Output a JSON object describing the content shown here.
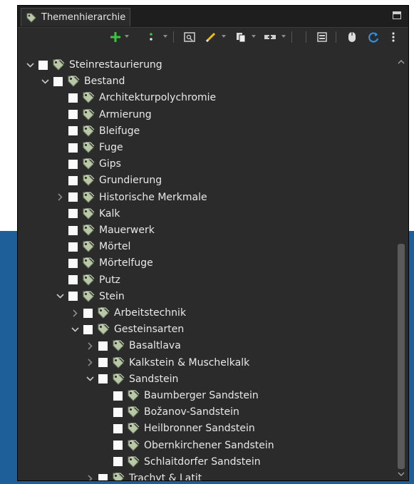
{
  "panel": {
    "tab_title": "Themenhierarchie"
  },
  "toolbar": {
    "icons": [
      "add-icon",
      "more-vert-icon",
      "search-window-icon",
      "pencil-icon",
      "copy-icon",
      "link-icon",
      "collapse-icon",
      "mouse-icon",
      "refresh-icon",
      "view-menu-icon"
    ]
  },
  "tree": {
    "rows": [
      {
        "label": "Steinrestaurierung",
        "depth": 0,
        "twisty": "open"
      },
      {
        "label": "Bestand",
        "depth": 1,
        "twisty": "open"
      },
      {
        "label": "Architekturpolychromie",
        "depth": 2,
        "twisty": "none"
      },
      {
        "label": "Armierung",
        "depth": 2,
        "twisty": "none"
      },
      {
        "label": "Bleifuge",
        "depth": 2,
        "twisty": "none"
      },
      {
        "label": "Fuge",
        "depth": 2,
        "twisty": "none"
      },
      {
        "label": "Gips",
        "depth": 2,
        "twisty": "none"
      },
      {
        "label": "Grundierung",
        "depth": 2,
        "twisty": "none"
      },
      {
        "label": "Historische Merkmale",
        "depth": 2,
        "twisty": "closed"
      },
      {
        "label": "Kalk",
        "depth": 2,
        "twisty": "none"
      },
      {
        "label": "Mauerwerk",
        "depth": 2,
        "twisty": "none"
      },
      {
        "label": "Mörtel",
        "depth": 2,
        "twisty": "none"
      },
      {
        "label": "Mörtelfuge",
        "depth": 2,
        "twisty": "none"
      },
      {
        "label": "Putz",
        "depth": 2,
        "twisty": "none"
      },
      {
        "label": "Stein",
        "depth": 2,
        "twisty": "open"
      },
      {
        "label": "Arbeitstechnik",
        "depth": 3,
        "twisty": "closed"
      },
      {
        "label": "Gesteinsarten",
        "depth": 3,
        "twisty": "open"
      },
      {
        "label": "Basaltlava",
        "depth": 4,
        "twisty": "closed"
      },
      {
        "label": "Kalkstein & Muschelkalk",
        "depth": 4,
        "twisty": "closed"
      },
      {
        "label": "Sandstein",
        "depth": 4,
        "twisty": "open"
      },
      {
        "label": "Baumberger Sandstein",
        "depth": 5,
        "twisty": "none"
      },
      {
        "label": "Božanov-Sandstein",
        "depth": 5,
        "twisty": "none"
      },
      {
        "label": "Heilbronner Sandstein",
        "depth": 5,
        "twisty": "none"
      },
      {
        "label": "Obernkirchener Sandstein",
        "depth": 5,
        "twisty": "none"
      },
      {
        "label": "Schlaitdorfer Sandstein",
        "depth": 5,
        "twisty": "none"
      },
      {
        "label": "Trachyt & Latit",
        "depth": 4,
        "twisty": "closed"
      }
    ]
  },
  "colors": {
    "panel_bg": "#2b2b2b",
    "tab_bar_bg": "#1e1e1e",
    "outer_accent": "#1f5f99",
    "tag_icon": "#b9c9a8",
    "text": "#e8e8e8"
  }
}
